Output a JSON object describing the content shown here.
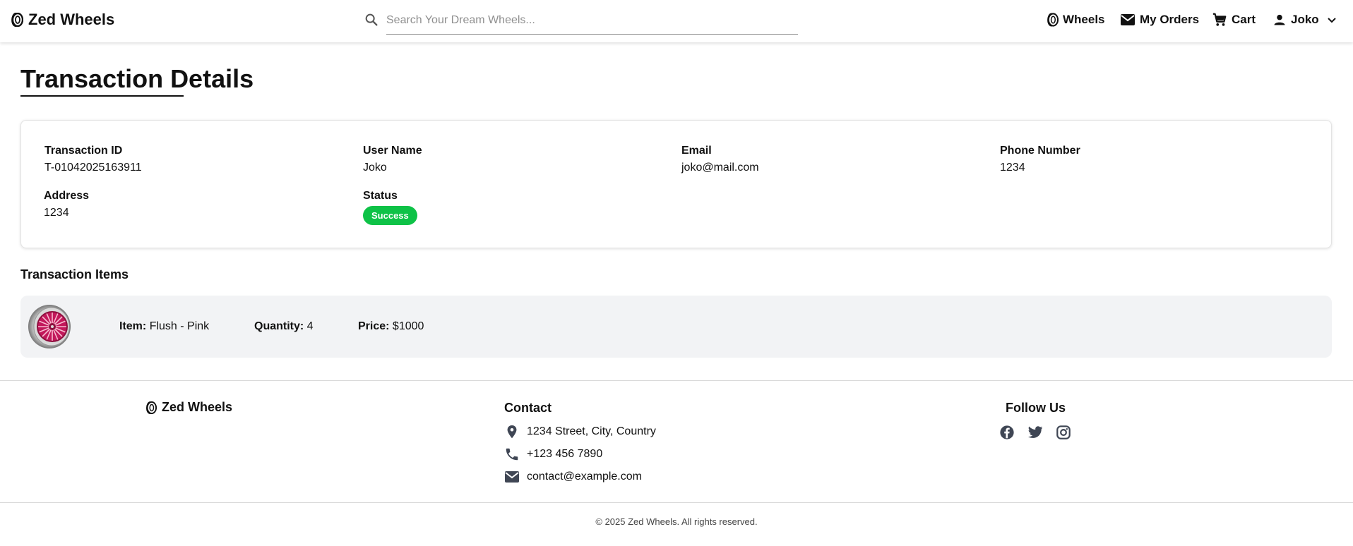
{
  "header": {
    "brand": "Zed Wheels",
    "search": {
      "placeholder": "Search Your Dream Wheels...",
      "value": ""
    },
    "nav": {
      "wheels": "Wheels",
      "orders": "My Orders",
      "cart": "Cart",
      "user": "Joko"
    }
  },
  "page": {
    "title": "Transaction Details"
  },
  "details": {
    "transaction_id": {
      "label": "Transaction ID",
      "value": "T-01042025163911"
    },
    "user_name": {
      "label": "User Name",
      "value": "Joko"
    },
    "email": {
      "label": "Email",
      "value": "joko@mail.com"
    },
    "phone": {
      "label": "Phone Number",
      "value": "1234"
    },
    "address": {
      "label": "Address",
      "value": "1234"
    },
    "status": {
      "label": "Status",
      "value": "Success",
      "color": "#0ec247"
    }
  },
  "items_section": {
    "title": "Transaction Items",
    "items": [
      {
        "item_label": "Item:",
        "item_value": "Flush - Pink",
        "quantity_label": "Quantity:",
        "quantity_value": "4",
        "price_label": "Price:",
        "price_value": "$1000",
        "image_icon": "pink-wheel-image"
      }
    ]
  },
  "footer": {
    "brand": "Zed Wheels",
    "contact": {
      "heading": "Contact",
      "address": "1234 Street, City, Country",
      "phone": "+123 456 7890",
      "email": "contact@example.com"
    },
    "follow": {
      "heading": "Follow Us",
      "icons": [
        "facebook-icon",
        "twitter-icon",
        "instagram-icon"
      ]
    },
    "copyright": "© 2025 Zed Wheels. All rights reserved."
  },
  "colors": {
    "accent_success": "#0ec247",
    "item_row_bg": "#f2f3f5",
    "footer_icon": "#3f4654"
  }
}
